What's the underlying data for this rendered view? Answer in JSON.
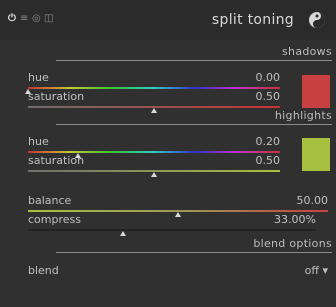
{
  "header": {
    "title": "split toning",
    "icons": [
      "power-icon",
      "presets-icon",
      "reset-icon",
      "multi-instance-icon",
      "module-logo-icon"
    ]
  },
  "sections": {
    "shadows": "shadows",
    "highlights": "highlights",
    "blend_options": "blend options"
  },
  "shadows": {
    "hue_label": "hue",
    "hue_value": "0.00",
    "hue_level": 0.0,
    "saturation_label": "saturation",
    "saturation_value": "0.50",
    "saturation_level": 0.5,
    "swatch_color": "#c84040"
  },
  "highlights": {
    "hue_label": "hue",
    "hue_value": "0.20",
    "hue_level": 0.2,
    "saturation_label": "saturation",
    "saturation_value": "0.50",
    "saturation_level": 0.5,
    "swatch_color": "#a8c040"
  },
  "balance": {
    "label": "balance",
    "value": "50.00",
    "level": 0.5
  },
  "compress": {
    "label": "compress",
    "value": "33.00%",
    "level": 0.33
  },
  "blend": {
    "label": "blend",
    "value": "off ▾"
  }
}
